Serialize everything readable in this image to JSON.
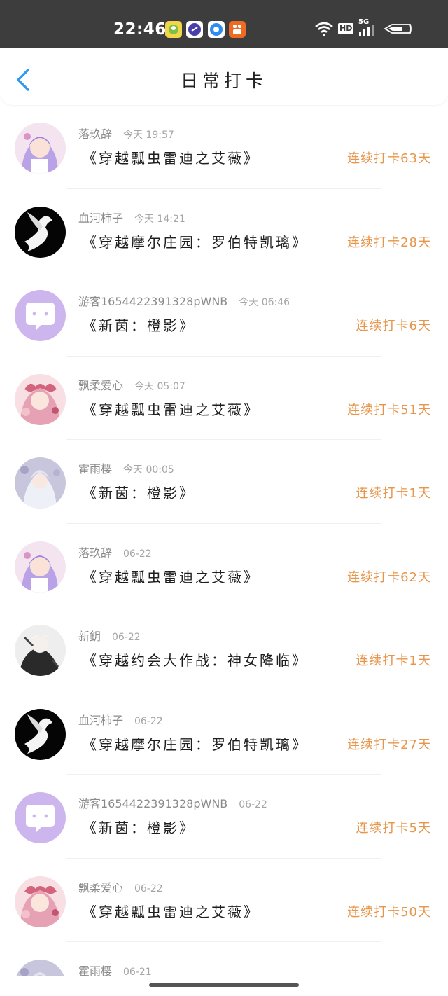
{
  "status_bar": {
    "time": "22:46",
    "network_label": "5G",
    "hd_label": "HD"
  },
  "header": {
    "title": "日常打卡"
  },
  "colors": {
    "streak": "#e6954a",
    "guest_avatar": "#cdb6ee"
  },
  "checkins": [
    {
      "username": "落玖辞",
      "time": "今天 19:57",
      "title": "《穿越瓢虫雷迪之艾薇》",
      "streak": "连续打卡63天",
      "avatar": "anime-girl-purple"
    },
    {
      "username": "血河柿子",
      "time": "今天 14:21",
      "title": "《穿越摩尔庄园：罗伯特凯璃》",
      "streak": "连续打卡28天",
      "avatar": "white-dove"
    },
    {
      "username": "游客1654422391328pWNB",
      "time": "今天 06:46",
      "title": "《新茵：橙影》",
      "streak": "连续打卡6天",
      "avatar": "guest-chat"
    },
    {
      "username": "飘柔爱心",
      "time": "今天 05:07",
      "title": "《穿越瓢虫雷迪之艾薇》",
      "streak": "连续打卡51天",
      "avatar": "anime-girl-pink"
    },
    {
      "username": "霍雨樱",
      "time": "今天 00:05",
      "title": "《新茵：橙影》",
      "streak": "连续打卡1天",
      "avatar": "anime-girl-white"
    },
    {
      "username": "落玖辞",
      "time": "06-22",
      "title": "《穿越瓢虫雷迪之艾薇》",
      "streak": "连续打卡62天",
      "avatar": "anime-girl-purple"
    },
    {
      "username": "新鈅",
      "time": "06-22",
      "title": "《穿越约会大作战：神女降临》",
      "streak": "连续打卡1天",
      "avatar": "anime-boy-mono"
    },
    {
      "username": "血河柿子",
      "time": "06-22",
      "title": "《穿越摩尔庄园：罗伯特凯璃》",
      "streak": "连续打卡27天",
      "avatar": "white-dove"
    },
    {
      "username": "游客1654422391328pWNB",
      "time": "06-22",
      "title": "《新茵：橙影》",
      "streak": "连续打卡5天",
      "avatar": "guest-chat"
    },
    {
      "username": "飘柔爱心",
      "time": "06-22",
      "title": "《穿越瓢虫雷迪之艾薇》",
      "streak": "连续打卡50天",
      "avatar": "anime-girl-pink"
    },
    {
      "username": "霍雨樱",
      "time": "06-21",
      "title": "",
      "streak": "",
      "avatar": "anime-girl-white"
    }
  ]
}
